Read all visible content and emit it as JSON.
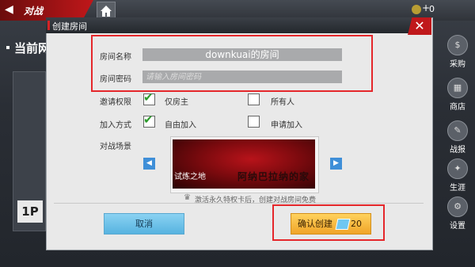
{
  "background": {
    "back_label": "对战",
    "coins_plus": "+",
    "coins_value": "0",
    "section_title": "当前网",
    "player_badge": "1P",
    "side_menu": [
      {
        "label": "采购",
        "icon": "shop-bag-icon"
      },
      {
        "label": "商店",
        "icon": "store-icon"
      },
      {
        "label": "战报",
        "icon": "report-icon"
      },
      {
        "label": "生涯",
        "icon": "career-icon"
      },
      {
        "label": "设置",
        "icon": "settings-gear-icon"
      }
    ]
  },
  "dialog": {
    "title": "创建房间",
    "close_symbol": "✕",
    "room_name_label": "房间名称",
    "room_name_value": "downkuai的房间",
    "room_password_label": "房间密码",
    "room_password_placeholder": "请输入房间密码",
    "invite_permission_label": "邀请权限",
    "invite_owner_only": "仅房主",
    "invite_everyone": "所有人",
    "join_method_label": "加入方式",
    "join_free": "自由加入",
    "join_apply": "申请加入",
    "scene_label": "对战场景",
    "scene_name": "试炼之地",
    "scene_art_text": "阿纳巴拉纳的家",
    "tip": "激活永久特权卡后，创建对战房间免费",
    "cancel_label": "取消",
    "confirm_label": "确认创建",
    "confirm_cost": "20"
  },
  "state": {
    "invite_owner_only_checked": true,
    "invite_everyone_checked": false,
    "join_free_checked": true,
    "join_apply_checked": false
  },
  "colors": {
    "accent_red": "#c0181b",
    "highlight_red": "#e5272b",
    "cancel_blue": "#57b3e0",
    "confirm_gold": "#f0a428"
  }
}
